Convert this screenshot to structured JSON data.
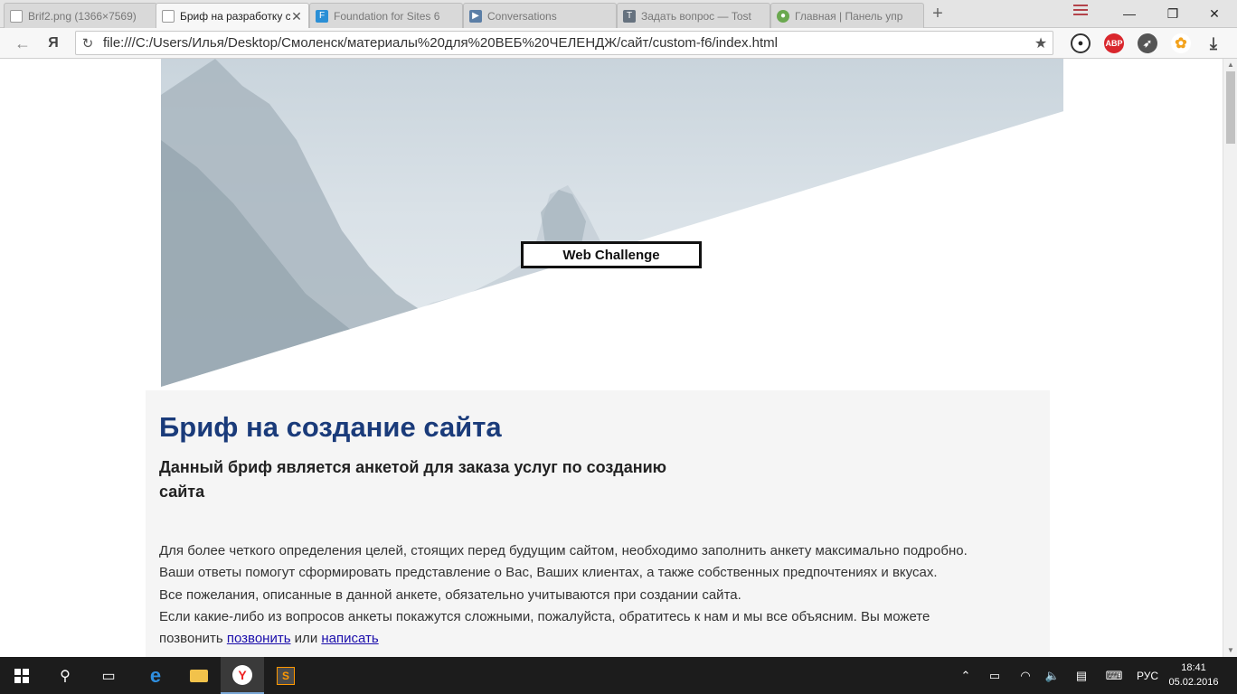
{
  "browser": {
    "tabs": [
      {
        "label": "Brif2.png (1366×7569)",
        "icon": "document-icon",
        "active": false
      },
      {
        "label": "Бриф на разработку с",
        "icon": "document-icon",
        "active": true
      },
      {
        "label": "Foundation for Sites 6",
        "icon": "foundation-icon",
        "active": false
      },
      {
        "label": "Conversations",
        "icon": "play-icon",
        "active": false
      },
      {
        "label": "Задать вопрос — Tost",
        "icon": "toster-icon",
        "active": false
      },
      {
        "label": "Главная | Панель упр",
        "icon": "panel-icon",
        "active": false
      }
    ],
    "new_tab": "+",
    "url": "file:///C:/Users/Илья/Desktop/Смоленск/материалы%20для%20ВЕБ%20ЧЕЛЕНДЖ/сайт/custom-f6/index.html",
    "yandex_label": "Я",
    "extensions": [
      {
        "name": "panda-icon",
        "label": ""
      },
      {
        "name": "adblock-icon",
        "label": "ABP"
      },
      {
        "name": "rocket-icon",
        "label": ""
      },
      {
        "name": "flower-icon",
        "label": ""
      },
      {
        "name": "download-icon",
        "label": ""
      }
    ]
  },
  "page": {
    "hero_logo": "Web Challenge",
    "title": "Бриф на создание сайта",
    "subtitle": "Данный бриф является анкетой для заказа услуг по созданию сайта",
    "intro_lines": [
      "Для более четкого определения целей, стоящих перед будущим сайтом, необходимо заполнить анкету максимально подробно.",
      "Ваши ответы помогут сформировать представление о Вас, Ваших клиентах, а также собственных предпочтениях и вкусах.",
      "Все пожелания, описанные в данной анкете, обязательно учитываются при создании сайта.",
      "Если какие-либо из вопросов анкеты покажутся сложными, пожалуйста, обратитесь к нам и мы все объясним. Вы можете"
    ],
    "contact_prefix": "позвонить ",
    "call_link": "позвонить",
    "contact_mid": " или ",
    "write_link": "написать"
  },
  "taskbar": {
    "language": "РУС",
    "time": "18:41",
    "date": "05.02.2016"
  },
  "colors": {
    "title": "#1a3b7a",
    "section_bg": "#f5f5f5",
    "taskbar": "#1c1c1c"
  }
}
